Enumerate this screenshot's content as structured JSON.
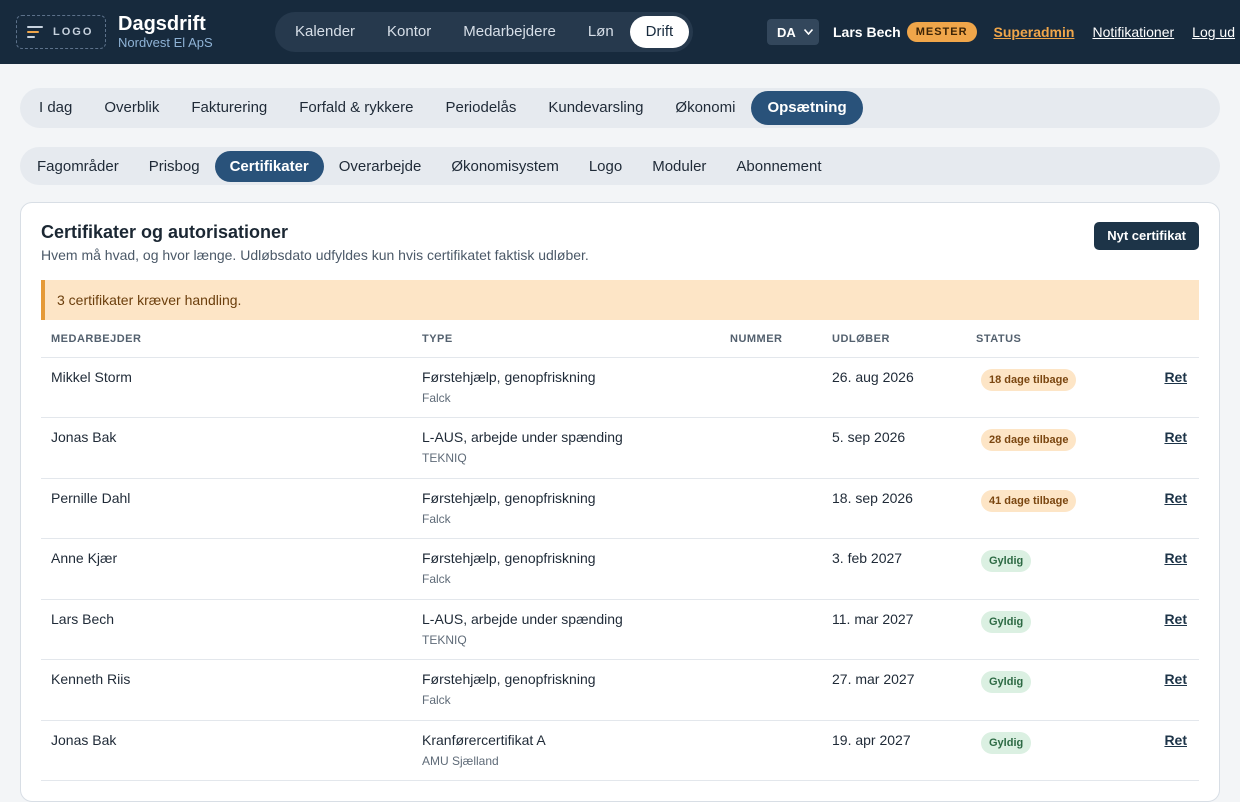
{
  "header": {
    "logo_text": "LOGO",
    "app_name": "Dagsdrift",
    "company": "Nordvest El ApS",
    "nav": [
      "Kalender",
      "Kontor",
      "Medarbejdere",
      "Løn",
      "Drift"
    ],
    "nav_active": "Drift",
    "language": "DA",
    "user_name": "Lars Bech",
    "role_badge": "MESTER",
    "superadmin": "Superadmin",
    "notifications": "Notifikationer",
    "logout": "Log ud"
  },
  "section_tabs": [
    "I dag",
    "Overblik",
    "Fakturering",
    "Forfald & rykkere",
    "Periodelås",
    "Kundevarsling",
    "Økonomi",
    "Opsætning"
  ],
  "section_active": "Opsætning",
  "sub_tabs": [
    "Fagområder",
    "Prisbog",
    "Certifikater",
    "Overarbejde",
    "Økonomisystem",
    "Logo",
    "Moduler",
    "Abonnement"
  ],
  "sub_active": "Certifikater",
  "card": {
    "title": "Certifikater og autorisationer",
    "subtitle": "Hvem må hvad, og hvor længe. Udløbsdato udfyldes kun hvis certifikatet faktisk udløber.",
    "new_button": "Nyt certifikat",
    "alert": "3 certifikater kræver handling."
  },
  "table": {
    "headers": {
      "employee": "MEDARBEJDER",
      "type": "TYPE",
      "number": "NUMMER",
      "expires": "UDLØBER",
      "status": "STATUS"
    },
    "rows": [
      {
        "employee": "Mikkel Storm",
        "type": "Førstehjælp, genopfriskning",
        "issuer": "Falck",
        "number": "",
        "expires": "26. aug 2026",
        "status": "18 dage tilbage",
        "status_kind": "warn",
        "action": "Ret"
      },
      {
        "employee": "Jonas Bak",
        "type": "L-AUS, arbejde under spænding",
        "issuer": "TEKNIQ",
        "number": "",
        "expires": "5. sep 2026",
        "status": "28 dage tilbage",
        "status_kind": "warn",
        "action": "Ret"
      },
      {
        "employee": "Pernille Dahl",
        "type": "Førstehjælp, genopfriskning",
        "issuer": "Falck",
        "number": "",
        "expires": "18. sep 2026",
        "status": "41 dage tilbage",
        "status_kind": "warn",
        "action": "Ret"
      },
      {
        "employee": "Anne Kjær",
        "type": "Førstehjælp, genopfriskning",
        "issuer": "Falck",
        "number": "",
        "expires": "3. feb 2027",
        "status": "Gyldig",
        "status_kind": "ok",
        "action": "Ret"
      },
      {
        "employee": "Lars Bech",
        "type": "L-AUS, arbejde under spænding",
        "issuer": "TEKNIQ",
        "number": "",
        "expires": "11. mar 2027",
        "status": "Gyldig",
        "status_kind": "ok",
        "action": "Ret"
      },
      {
        "employee": "Kenneth Riis",
        "type": "Førstehjælp, genopfriskning",
        "issuer": "Falck",
        "number": "",
        "expires": "27. mar 2027",
        "status": "Gyldig",
        "status_kind": "ok",
        "action": "Ret"
      },
      {
        "employee": "Jonas Bak",
        "type": "Kranførercertifikat A",
        "issuer": "AMU Sjælland",
        "number": "",
        "expires": "19. apr 2027",
        "status": "Gyldig",
        "status_kind": "ok",
        "action": "Ret"
      }
    ]
  },
  "colors": {
    "header_bg": "#172a3d",
    "accent": "#f0a64a",
    "active_tab": "#29527a",
    "warn_badge": "#fde5c6",
    "ok_badge": "#dbf0e2"
  }
}
